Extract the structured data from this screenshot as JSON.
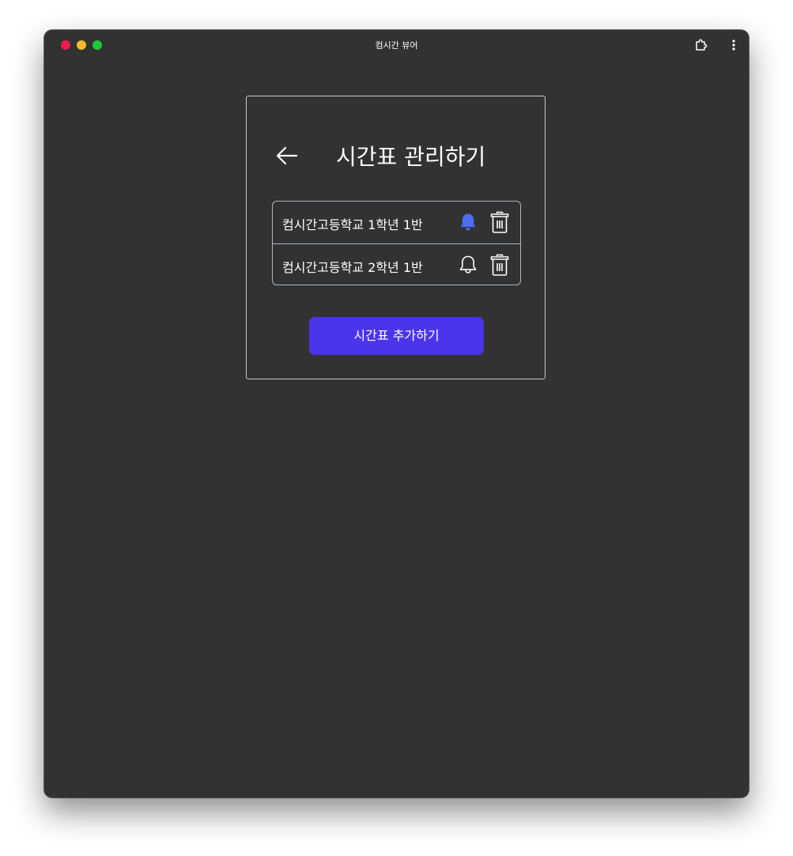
{
  "window": {
    "title": "컴시간 뷰어"
  },
  "colors": {
    "background": "#323232",
    "accent": "#4a35ea",
    "bell_active": "#4d6cf0",
    "traffic_close": "#ee1c52",
    "traffic_minimize": "#f5bb2b",
    "traffic_maximize": "#1ec93c"
  },
  "icons": {
    "extension": "puzzle-icon",
    "menu": "more-vertical-icon",
    "back": "arrow-left-icon",
    "notification_on": "bell-filled-icon",
    "notification_off": "bell-outline-icon",
    "delete": "trash-icon"
  },
  "page": {
    "title": "시간표 관리하기"
  },
  "timetables": [
    {
      "label": "컴시간고등학교 1학년 1반",
      "notification": true
    },
    {
      "label": "컴시간고등학교 2학년 1반",
      "notification": false
    }
  ],
  "add_button": {
    "label": "시간표 추가하기"
  }
}
